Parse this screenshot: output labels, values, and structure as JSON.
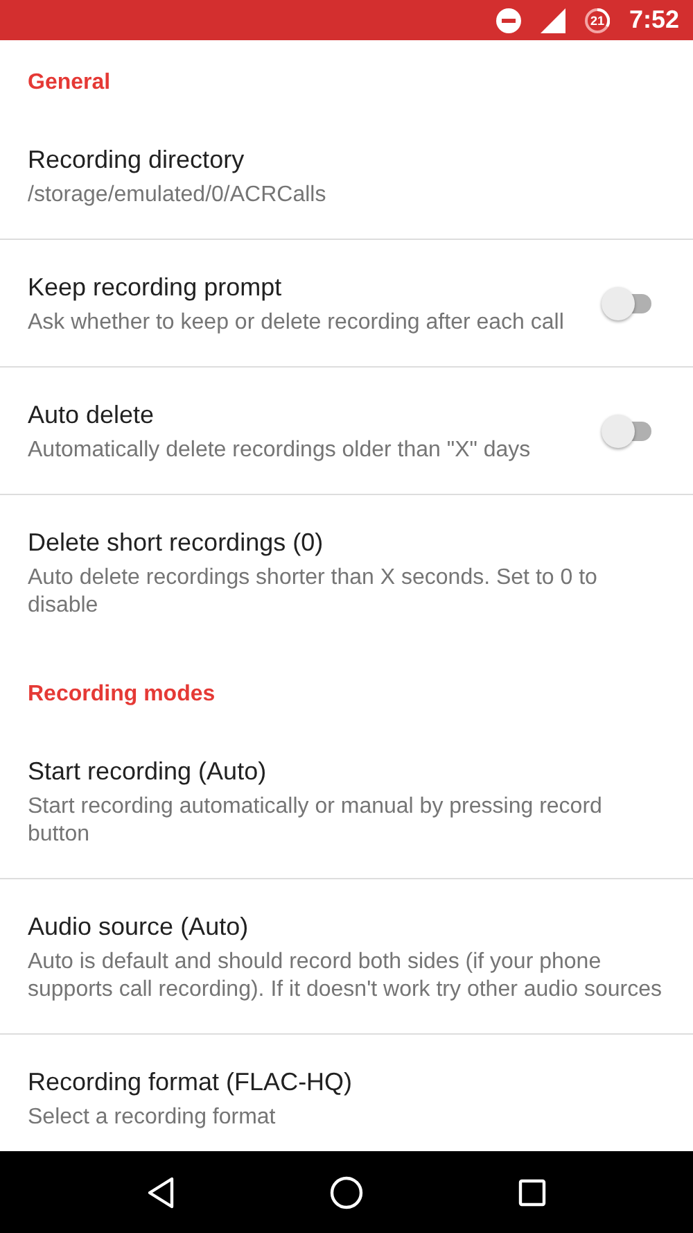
{
  "status_bar": {
    "notification_count": "21",
    "time": "7:52"
  },
  "sections": [
    {
      "header": "General",
      "items": [
        {
          "kind": "text",
          "title": "Recording directory",
          "subtitle": "/storage/emulated/0/ACRCalls"
        },
        {
          "kind": "switch",
          "title": "Keep recording prompt",
          "subtitle": "Ask whether to keep or delete recording after each call",
          "on": false
        },
        {
          "kind": "switch",
          "title": "Auto delete",
          "subtitle": "Automatically delete recordings older than \"X\" days",
          "on": false
        },
        {
          "kind": "text",
          "title": "Delete short recordings (0)",
          "subtitle": "Auto delete recordings shorter than X seconds. Set to 0 to disable"
        }
      ]
    },
    {
      "header": "Recording modes",
      "items": [
        {
          "kind": "text",
          "title": "Start recording (Auto)",
          "subtitle": "Start recording automatically or manual by pressing record button"
        },
        {
          "kind": "text",
          "title": "Audio source (Auto)",
          "subtitle": "Auto is default and should record both sides (if your phone supports call recording). If it doesn't work try other audio sources"
        },
        {
          "kind": "text",
          "title": "Recording format (FLAC-HQ)",
          "subtitle": "Select a recording format"
        }
      ]
    }
  ]
}
